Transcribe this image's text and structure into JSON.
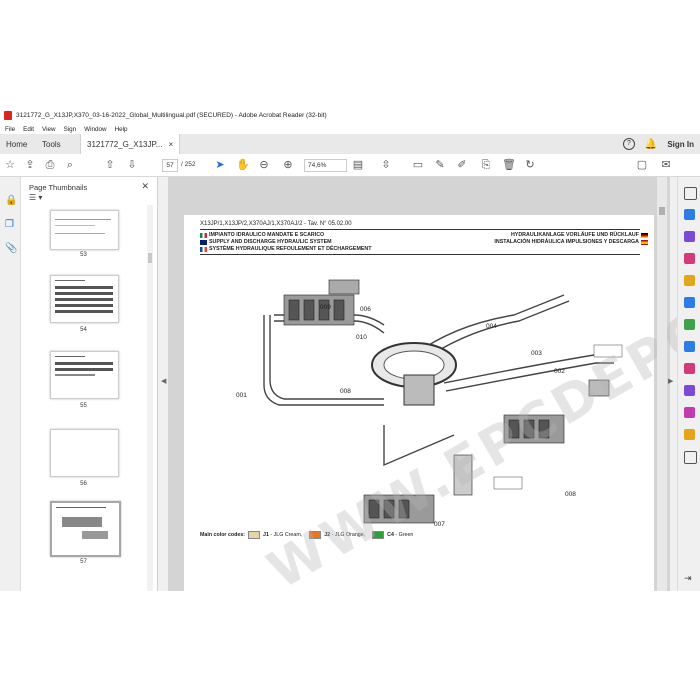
{
  "window": {
    "title": "3121772_G_X13JP,X370_03-16-2022_Global_Multilingual.pdf (SECURED) - Adobe Acrobat Reader (32-bit)"
  },
  "menu": [
    "File",
    "Edit",
    "View",
    "Sign",
    "Window",
    "Help"
  ],
  "tabs": {
    "home": "Home",
    "tools": "Tools",
    "doc": "3121772_G_X13JP..."
  },
  "account": {
    "signin": "Sign In",
    "help": "?"
  },
  "toolbar": {
    "page_current": "57",
    "page_total": "/ 252",
    "zoom": "74,6%"
  },
  "thumbnails": {
    "title": "Page Thumbnails",
    "pages": [
      "53",
      "54",
      "55",
      "56",
      "57"
    ]
  },
  "document": {
    "header": "X13JP/1,X13JP/2,X370AJ/1,X370AJ/2 - Tav. N° 05.02.00",
    "title_it": "IMPIANTO IDRAULICO MANDATE E SCARICO",
    "title_en": "SUPPLY AND DISCHARGE HYDRAULIC SYSTEM",
    "title_fr": "SYSTÈME HYDRAULIQUE REFOULEMENT ET DÉCHARGEMENT",
    "title_de": "HYDRAULIKANLAGE VORLÄUFE UND RÜCKLAUF",
    "title_es": "INSTALACIÓN HIDRÁULICA IMPULSIONES Y DESCARGA",
    "callouts": [
      "009",
      "006",
      "010",
      "004",
      "003",
      "002",
      "001",
      "008",
      "008",
      "007"
    ],
    "legend_label": "Main color codes:",
    "legend_items": [
      {
        "code": "J1",
        "name": " - JLG Cream,",
        "color": "#e6d4a8"
      },
      {
        "code": "J2",
        "name": " - JLG Orange,",
        "color": "#e8761e"
      },
      {
        "code": "C4",
        "name": " - Green",
        "color": "#2e9e3e"
      }
    ],
    "watermark": "WWW.EPCDEPO.COM"
  }
}
